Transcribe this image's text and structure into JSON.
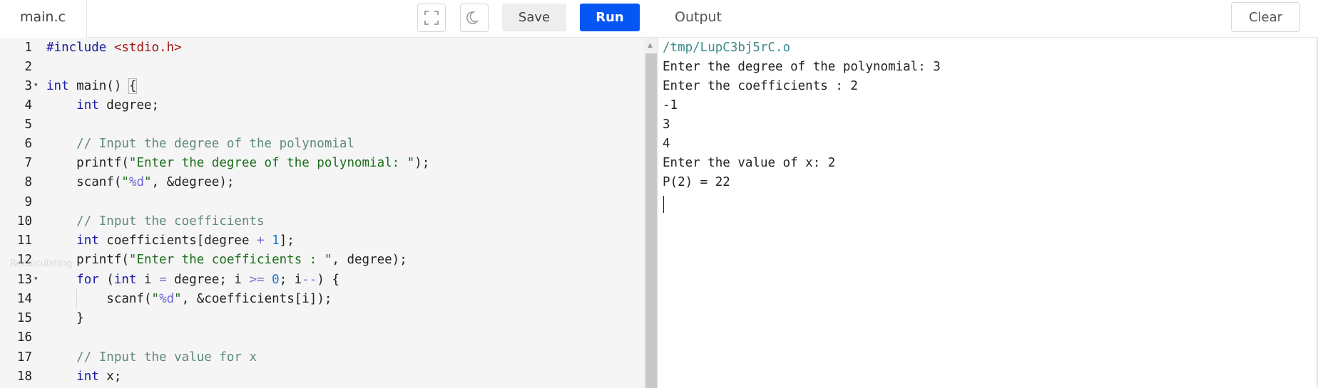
{
  "header": {
    "file_tab": "main.c",
    "save_label": "Save",
    "run_label": "Run",
    "output_title": "Output",
    "clear_label": "Clear",
    "fullscreen_icon": "fullscreen-icon",
    "theme_icon": "moon-icon"
  },
  "editor": {
    "line_numbers": [
      "1",
      "2",
      "3",
      "4",
      "5",
      "6",
      "7",
      "8",
      "9",
      "10",
      "11",
      "12",
      "13",
      "14",
      "15",
      "16",
      "17",
      "18"
    ],
    "ghost_text": "Recalculating"
  },
  "output": {
    "lines": [
      "/tmp/LupC3bj5rC.o",
      "Enter the degree of the polynomial: 3",
      "Enter the coefficients : 2",
      "-1",
      "3",
      "4",
      "Enter the value of x: 2",
      "P(2) = 22"
    ]
  },
  "colors": {
    "run_button": "#0556f3",
    "keyword": "#1a1aa6",
    "string_include": "#a31515",
    "string": "#1b6e1b",
    "comment": "#5f8a7a",
    "number": "#1a7ad6"
  }
}
